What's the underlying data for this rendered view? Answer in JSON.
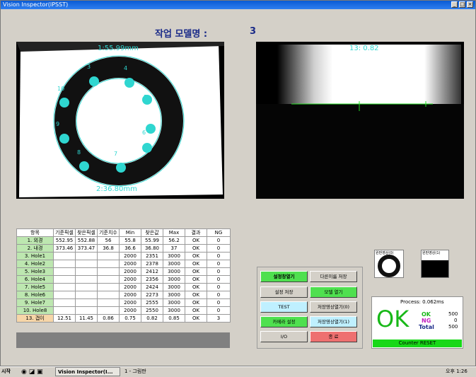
{
  "window": {
    "title": "Vision Inspector(IPSST)",
    "min": "_",
    "max": "□",
    "close": "×"
  },
  "model": {
    "label": "작업 모델명 :",
    "number": "3"
  },
  "left_image": {
    "top_measure": "1:55.99mm",
    "bottom_measure": "2:36.80mm",
    "holes": [
      "3",
      "4",
      "5",
      "6",
      "7",
      "8",
      "9",
      "10"
    ]
  },
  "right_image": {
    "measure": "13: 0.82"
  },
  "table": {
    "headers": [
      "항목",
      "기준픽셀",
      "찾은픽셀",
      "기준치수",
      "Min",
      "찾은값",
      "Max",
      "결과",
      "NG"
    ],
    "rows": [
      [
        "1. 외경",
        "552.95",
        "552.88",
        "56",
        "55.8",
        "55.99",
        "56.2",
        "OK",
        "0"
      ],
      [
        "2. 내경",
        "373.46",
        "373.47",
        "36.8",
        "36.6",
        "36.80",
        "37",
        "OK",
        "0"
      ],
      [
        "3. Hole1",
        "",
        "",
        "",
        "2000",
        "2351",
        "3000",
        "OK",
        "0"
      ],
      [
        "4. Hole2",
        "",
        "",
        "",
        "2000",
        "2378",
        "3000",
        "OK",
        "0"
      ],
      [
        "5. Hole3",
        "",
        "",
        "",
        "2000",
        "2412",
        "3000",
        "OK",
        "0"
      ],
      [
        "6. Hole4",
        "",
        "",
        "",
        "2000",
        "2356",
        "3000",
        "OK",
        "0"
      ],
      [
        "7. Hole5",
        "",
        "",
        "",
        "2000",
        "2424",
        "3000",
        "OK",
        "0"
      ],
      [
        "8. Hole6",
        "",
        "",
        "",
        "2000",
        "2273",
        "3000",
        "OK",
        "0"
      ],
      [
        "9. Hole7",
        "",
        "",
        "",
        "2000",
        "2555",
        "3000",
        "OK",
        "0"
      ],
      [
        "10. Hole8",
        "",
        "",
        "",
        "2000",
        "2550",
        "3000",
        "OK",
        "0"
      ],
      [
        "13. 갭이",
        "12.51",
        "11.45",
        "0.86",
        "0.75",
        "0.82",
        "0.85",
        "OK",
        "3"
      ]
    ]
  },
  "buttons": {
    "settings_open": "설정창열기",
    "save_as": "다른이름 저장",
    "settings_save": "설정 저장",
    "model_open": "모델 열기",
    "test": "TEST",
    "save_image0": "저장영상열기(0)",
    "camera_settings": "카메라 설정",
    "save_image1": "저장영상열기(1)",
    "io": "I/O",
    "exit": "종 료"
  },
  "thumbs": {
    "thumb0": "원판영상(0)",
    "thumb1": "원판영상(1)"
  },
  "result": {
    "process": "Process: 0.062ms",
    "status": "OK",
    "ok_label": "OK",
    "ok_count": "500",
    "ng_label": "NG",
    "ng_count": "0",
    "total_label": "Total",
    "total_count": "500",
    "reset": "Counter RESET"
  },
  "taskbar": {
    "start": "시작",
    "task1": "Vision Inspector(I...",
    "task2": "1 - 그림판",
    "time": "오후 1:26"
  },
  "colors": {
    "accent_cyan": "#2fd6d0",
    "ok_green": "#18b818",
    "button_green": "#4fe04f",
    "button_red": "#ee7070",
    "button_cyan": "#bff0ff"
  }
}
